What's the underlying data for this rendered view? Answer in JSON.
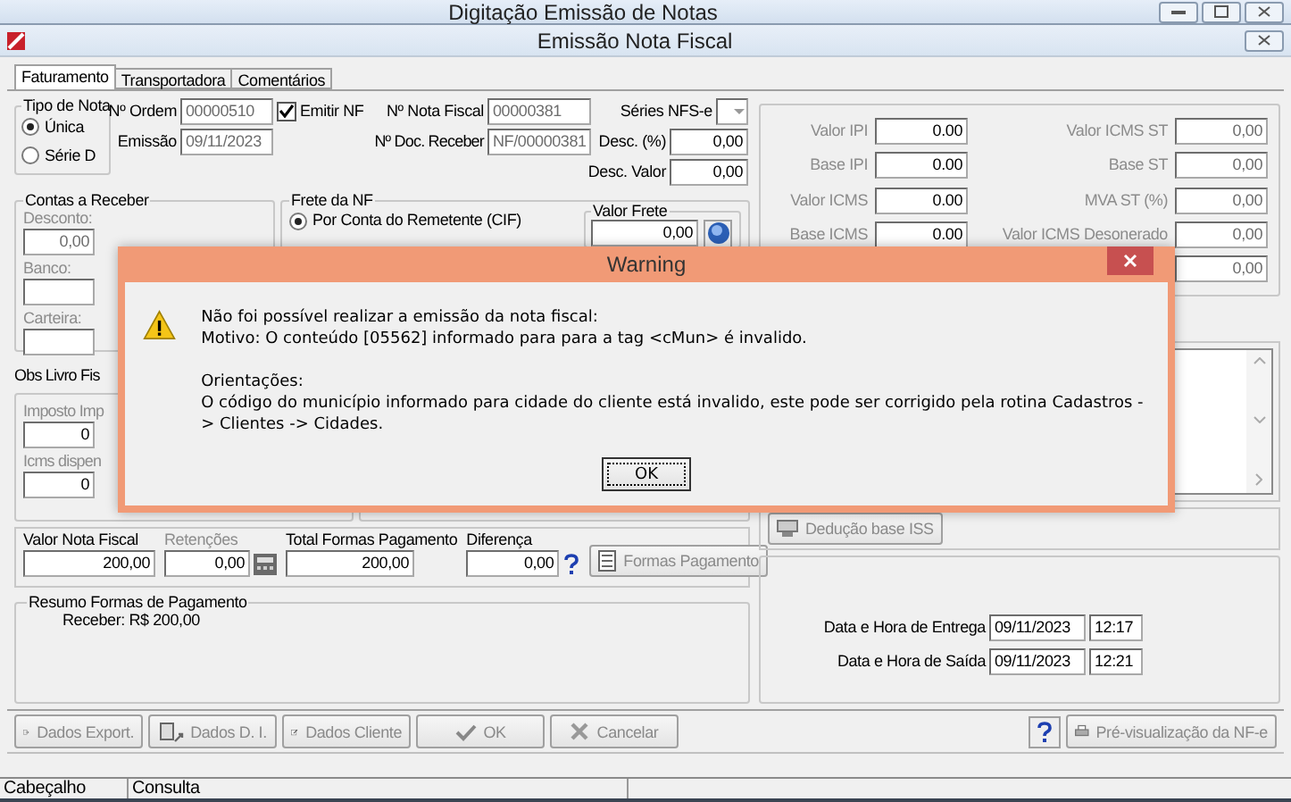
{
  "back_window": {
    "title": "Digitação Emissão de Notas"
  },
  "window": {
    "title": "Emissão Nota Fiscal"
  },
  "tabs": [
    {
      "label": "Faturamento",
      "selected": true
    },
    {
      "label": "Transportadora",
      "selected": false
    },
    {
      "label": "Comentários",
      "selected": false
    }
  ],
  "tipo_de_nota": {
    "title": "Tipo de Nota",
    "options": [
      {
        "label": "Única",
        "selected": true
      },
      {
        "label": "Série D",
        "selected": false
      }
    ]
  },
  "header": {
    "ordem": {
      "label": "Nº Ordem",
      "value": "00000510"
    },
    "emitir_nf": {
      "label": "Emitir NF",
      "checked": true
    },
    "nota_fiscal": {
      "label": "Nº Nota Fiscal",
      "value": "00000381"
    },
    "series_nfse": {
      "label": "Séries NFS-e"
    },
    "emissao": {
      "label": "Emissão",
      "value": "09/11/2023"
    },
    "doc_receber": {
      "label": "Nº Doc. Receber",
      "value": "NF/00000381"
    },
    "desc_pct": {
      "label": "Desc. (%)",
      "value": "0,00"
    },
    "desc_valor": {
      "label": "Desc. Valor",
      "value": "0,00"
    }
  },
  "contas_a_receber": {
    "title": "Contas a Receber",
    "disabled": true,
    "fields": [
      {
        "label": "Desconto:",
        "value": "0,00"
      },
      {
        "label": "Banco:"
      },
      {
        "label": "Carteira:"
      }
    ]
  },
  "frete": {
    "title": "Frete da NF",
    "options": [
      {
        "label": "Por Conta do Remetente (CIF)",
        "selected": true
      }
    ],
    "valor_frete": {
      "title": "Valor Frete",
      "value": "0,00"
    }
  },
  "obs_livro": {
    "title": "Obs Livro Fis",
    "disabled": true,
    "fields": [
      {
        "label": "Imposto Imp",
        "value": "0"
      },
      {
        "label": "Icms dispen",
        "value": "0"
      }
    ]
  },
  "totals": {
    "valor_nota": {
      "label": "Valor Nota Fiscal",
      "value": "200,00",
      "disabled": false
    },
    "retencoes": {
      "label": "Retenções",
      "value": "0,00",
      "disabled": true
    },
    "total_formas": {
      "label": "Total Formas Pagamento",
      "value": "200,00",
      "disabled": false
    },
    "diferenca": {
      "label": "Diferença",
      "value": "0,00",
      "disabled": false
    },
    "formas_button": {
      "label": "Formas Pagamento",
      "disabled": true
    }
  },
  "resumo": {
    "title": "Resumo Formas de Pagamento",
    "text": "Receber: R$ 200,00"
  },
  "impostos": {
    "disabled": true,
    "rows": [
      {
        "left": {
          "label": "Valor IPI",
          "value": "0.00"
        },
        "right": {
          "label": "Valor ICMS ST",
          "value": "0,00"
        }
      },
      {
        "left": {
          "label": "Base IPI",
          "value": "0.00"
        },
        "right": {
          "label": "Base ST",
          "value": "0,00"
        }
      },
      {
        "left": {
          "label": "Valor ICMS",
          "value": "0.00"
        },
        "right": {
          "label": "MVA ST (%)",
          "value": "0,00"
        }
      },
      {
        "left": {
          "label": "Base ICMS",
          "value": "0.00"
        },
        "right": {
          "label": "Valor ICMS Desonerado",
          "value": "0,00"
        }
      },
      {
        "right": {
          "value": "0,00"
        }
      }
    ]
  },
  "deducao_button": {
    "label": "Dedução base ISS",
    "disabled": true
  },
  "datas": [
    {
      "label": "Data e Hora de Entrega",
      "date": "09/11/2023",
      "time": "12:17"
    },
    {
      "label": "Data e Hora de Saída",
      "date": "09/11/2023",
      "time": "12:21"
    }
  ],
  "toolbar": [
    {
      "label": "Dados Export.",
      "kind": "export",
      "disabled": true
    },
    {
      "label": "Dados D. I.",
      "kind": "import",
      "disabled": true
    },
    {
      "label": "Dados Cliente",
      "kind": "edit",
      "disabled": true
    },
    {
      "label": "OK",
      "kind": "ok",
      "disabled": true
    },
    {
      "label": "Cancelar",
      "kind": "cancel",
      "disabled": true
    }
  ],
  "preview_button": {
    "label": "Pré-visualização da NF-e",
    "disabled": true
  },
  "status_bar": [
    "Cabeçalho",
    "Consulta"
  ],
  "dialog": {
    "title": "Warning",
    "lines": [
      "Não foi possível realizar a emissão da nota fiscal:",
      "Motivo: O conteúdo [05562] informado para para a tag <cMun> é invalido.",
      "Orientações:",
      "O código do município informado para cidade do cliente está invalido, este pode ser corrigido pela rotina Cadastros -> Clientes -> Cidades."
    ],
    "button": "OK"
  }
}
